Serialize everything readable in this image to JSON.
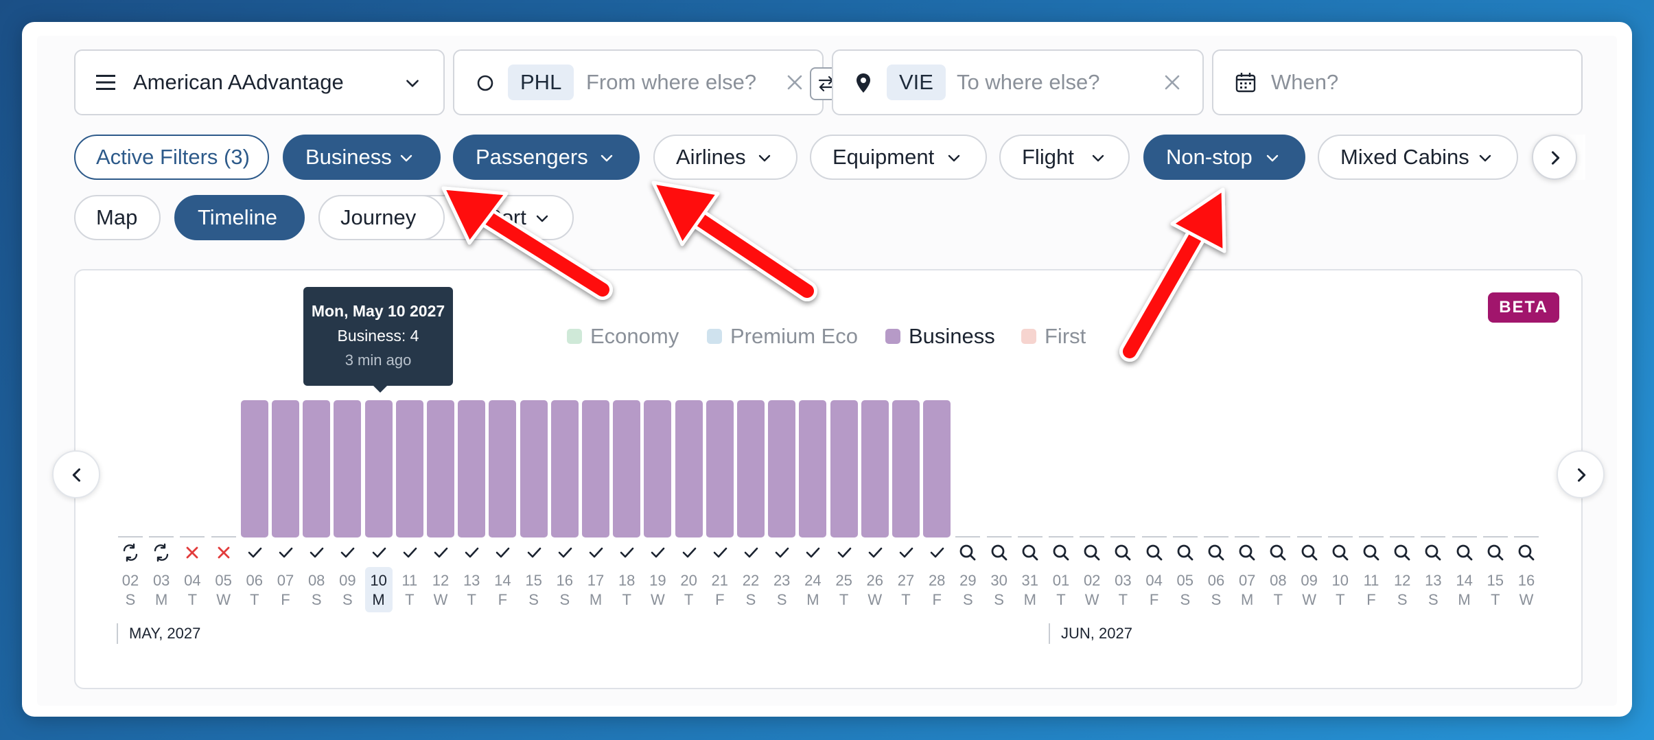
{
  "search": {
    "program": "American AAdvantage",
    "origin_code": "PHL",
    "origin_placeholder": "From where else?",
    "destination_code": "VIE",
    "destination_placeholder": "To where else?",
    "date_placeholder": "When?"
  },
  "filters": {
    "active_filters_label": "Active Filters (3)",
    "pills": [
      {
        "label": "Business",
        "active": true
      },
      {
        "label": "Passengers",
        "active": true
      },
      {
        "label": "Airlines",
        "active": false
      },
      {
        "label": "Equipment",
        "active": false
      },
      {
        "label": "Flight",
        "active": false
      },
      {
        "label": "Non-stop",
        "active": true
      },
      {
        "label": "Mixed Cabins",
        "active": false
      }
    ]
  },
  "views": {
    "map": "Map",
    "timeline": "Timeline",
    "journey": "Journey",
    "sort": "Sort"
  },
  "chart": {
    "beta_badge": "BETA",
    "legend": [
      {
        "label": "Economy",
        "color": "#cfe9d8",
        "active": false
      },
      {
        "label": "Premium Eco",
        "color": "#cfe2ee",
        "active": false
      },
      {
        "label": "Business",
        "color": "#b69ac7",
        "active": true
      },
      {
        "label": "First",
        "color": "#f6d4cf",
        "active": false
      }
    ],
    "tooltip": {
      "date": "Mon, May 10 2027",
      "value": "Business: 4",
      "updated": "3 min ago"
    },
    "months": [
      "MAY, 2027",
      "JUN, 2027"
    ]
  },
  "chart_data": {
    "type": "bar",
    "series": [
      {
        "name": "Business"
      }
    ],
    "selected_index": 8,
    "days": [
      {
        "d": "02",
        "w": "S",
        "s": "refresh",
        "v": 0
      },
      {
        "d": "03",
        "w": "M",
        "s": "refresh",
        "v": 0
      },
      {
        "d": "04",
        "w": "T",
        "s": "none",
        "v": 0
      },
      {
        "d": "05",
        "w": "W",
        "s": "none",
        "v": 0
      },
      {
        "d": "06",
        "w": "T",
        "s": "check",
        "v": 4
      },
      {
        "d": "07",
        "w": "F",
        "s": "check",
        "v": 4
      },
      {
        "d": "08",
        "w": "S",
        "s": "check",
        "v": 4
      },
      {
        "d": "09",
        "w": "S",
        "s": "check",
        "v": 4
      },
      {
        "d": "10",
        "w": "M",
        "s": "check",
        "v": 4
      },
      {
        "d": "11",
        "w": "T",
        "s": "check",
        "v": 4
      },
      {
        "d": "12",
        "w": "W",
        "s": "check",
        "v": 4
      },
      {
        "d": "13",
        "w": "T",
        "s": "check",
        "v": 4
      },
      {
        "d": "14",
        "w": "F",
        "s": "check",
        "v": 4
      },
      {
        "d": "15",
        "w": "S",
        "s": "check",
        "v": 4
      },
      {
        "d": "16",
        "w": "S",
        "s": "check",
        "v": 4
      },
      {
        "d": "17",
        "w": "M",
        "s": "check",
        "v": 4
      },
      {
        "d": "18",
        "w": "T",
        "s": "check",
        "v": 4
      },
      {
        "d": "19",
        "w": "W",
        "s": "check",
        "v": 4
      },
      {
        "d": "20",
        "w": "T",
        "s": "check",
        "v": 4
      },
      {
        "d": "21",
        "w": "F",
        "s": "check",
        "v": 4
      },
      {
        "d": "22",
        "w": "S",
        "s": "check",
        "v": 4
      },
      {
        "d": "23",
        "w": "S",
        "s": "check",
        "v": 4
      },
      {
        "d": "24",
        "w": "M",
        "s": "check",
        "v": 4
      },
      {
        "d": "25",
        "w": "T",
        "s": "check",
        "v": 4
      },
      {
        "d": "26",
        "w": "W",
        "s": "check",
        "v": 4
      },
      {
        "d": "27",
        "w": "T",
        "s": "check",
        "v": 4
      },
      {
        "d": "28",
        "w": "F",
        "s": "check",
        "v": 4
      },
      {
        "d": "29",
        "w": "S",
        "s": "search",
        "v": 0
      },
      {
        "d": "30",
        "w": "S",
        "s": "search",
        "v": 0
      },
      {
        "d": "31",
        "w": "M",
        "s": "search",
        "v": 0
      },
      {
        "d": "01",
        "w": "T",
        "s": "search",
        "v": 0
      },
      {
        "d": "02",
        "w": "W",
        "s": "search",
        "v": 0
      },
      {
        "d": "03",
        "w": "T",
        "s": "search",
        "v": 0
      },
      {
        "d": "04",
        "w": "F",
        "s": "search",
        "v": 0
      },
      {
        "d": "05",
        "w": "S",
        "s": "search",
        "v": 0
      },
      {
        "d": "06",
        "w": "S",
        "s": "search",
        "v": 0
      },
      {
        "d": "07",
        "w": "M",
        "s": "search",
        "v": 0
      },
      {
        "d": "08",
        "w": "T",
        "s": "search",
        "v": 0
      },
      {
        "d": "09",
        "w": "W",
        "s": "search",
        "v": 0
      },
      {
        "d": "10",
        "w": "T",
        "s": "search",
        "v": 0
      },
      {
        "d": "11",
        "w": "F",
        "s": "search",
        "v": 0
      },
      {
        "d": "12",
        "w": "S",
        "s": "search",
        "v": 0
      },
      {
        "d": "13",
        "w": "S",
        "s": "search",
        "v": 0
      },
      {
        "d": "14",
        "w": "M",
        "s": "search",
        "v": 0
      },
      {
        "d": "15",
        "w": "T",
        "s": "search",
        "v": 0
      },
      {
        "d": "16",
        "w": "W",
        "s": "search",
        "v": 0
      }
    ]
  }
}
